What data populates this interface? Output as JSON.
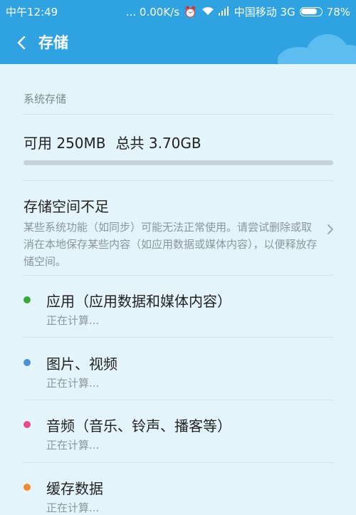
{
  "status_bar": {
    "time": "中午12:49",
    "speed": "... 0.00K/s",
    "carrier": "中国移动 3G",
    "battery": "78%"
  },
  "header": {
    "title": "存储",
    "back_icon": "back-arrow-icon"
  },
  "system_storage": {
    "section_label": "系统存储",
    "available": "可用 250MB",
    "total": "总共 3.70GB"
  },
  "warning": {
    "title": "存储空间不足",
    "description": "某些系统功能（如同步）可能无法正常使用。请尝试删除或取消在本地保存某些内容（如应用数据或媒体内容），以便释放存储空间。"
  },
  "categories": [
    {
      "label": "应用（应用数据和媒体内容）",
      "status": "正在计算...",
      "color": "#3aa93c"
    },
    {
      "label": "图片、视频",
      "status": "正在计算...",
      "color": "#4a8fd8"
    },
    {
      "label": "音频（音乐、铃声、播客等）",
      "status": "正在计算...",
      "color": "#e84a8a"
    },
    {
      "label": "缓存数据",
      "status": "正在计算...",
      "color": "#f08a2e"
    }
  ],
  "colors": {
    "accent": "#2fa3e2",
    "background": "#e3f4fb"
  }
}
